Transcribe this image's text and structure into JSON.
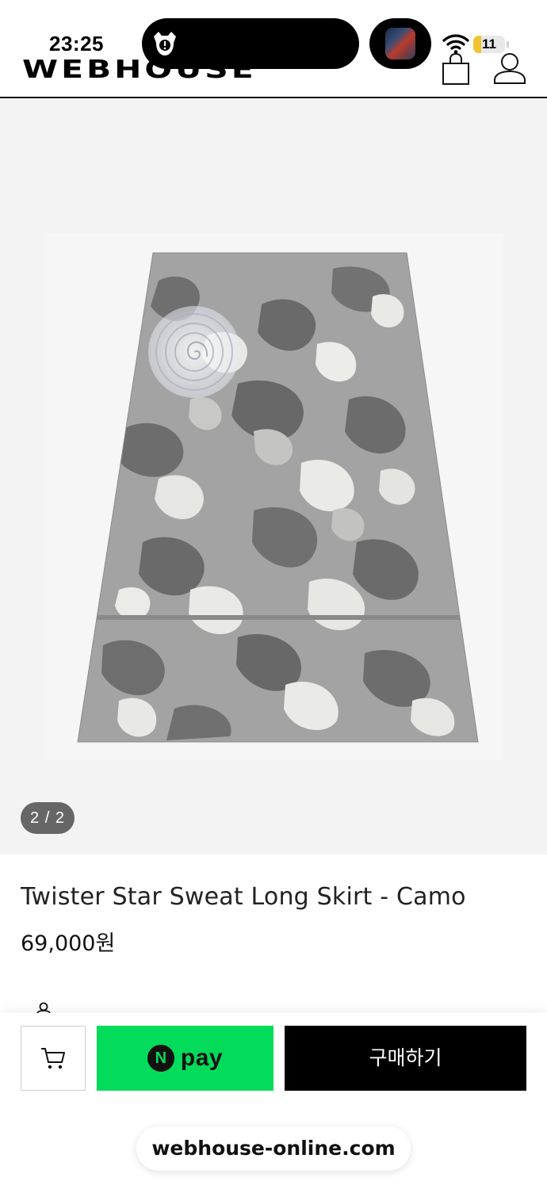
{
  "status_bar": {
    "time": "23:25",
    "battery_level": "11",
    "icons": [
      "dynamic-island-app-icon",
      "now-playing-thumbnail",
      "wifi-icon",
      "battery-icon"
    ]
  },
  "header": {
    "logo": "WEBHOUSE",
    "icons": [
      "shopping-bag-icon",
      "user-icon"
    ]
  },
  "gallery": {
    "counter": "2 / 2",
    "image_description_icon": "camo-skirt-image"
  },
  "product": {
    "title": "Twister Star Sweat Long Skirt - Camo",
    "price": "69,000원"
  },
  "actions": {
    "cart_icon": "cart-icon",
    "npay_n": "N",
    "npay_label": "pay",
    "buy_label": "구매하기"
  },
  "browser": {
    "url": "webhouse-online.com"
  },
  "colors": {
    "npay_green": "#03db5a",
    "buy_black": "#000000",
    "battery_yellow": "#f2c230",
    "counter_gray": "#666666"
  }
}
